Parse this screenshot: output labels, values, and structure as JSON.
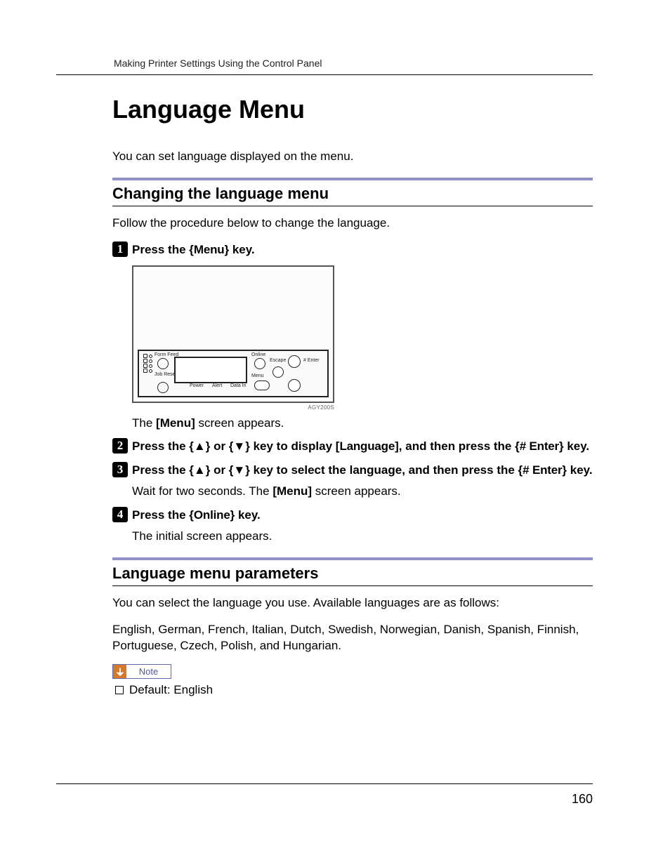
{
  "running_head": "Making Printer Settings Using the Control Panel",
  "title": "Language Menu",
  "intro": "You can set language displayed on the menu.",
  "section1": {
    "heading": "Changing the language menu",
    "lead": "Follow the procedure below to change the language."
  },
  "steps": {
    "s1": {
      "num": "1",
      "pre": "Press the ",
      "key_open": "{",
      "key_label": "Menu",
      "key_close": "}",
      "post": " key.",
      "follow": "The [Menu] screen appears."
    },
    "s2": {
      "num": "2",
      "pre": "Press the ",
      "k1o": "{",
      "k1": "▲",
      "k1c": "}",
      "or": " or ",
      "k2o": "{",
      "k2": "▼",
      "k2c": "}",
      "mid": " key to display ",
      "target_o": "[",
      "target": "Language",
      "target_c": "]",
      "mid2": ", and then press the ",
      "k3o": "{",
      "k3": "# Enter",
      "k3c": "}",
      "post": " key."
    },
    "s3": {
      "num": "3",
      "pre": "Press the ",
      "k1o": "{",
      "k1": "▲",
      "k1c": "}",
      "or": " or ",
      "k2o": "{",
      "k2": "▼",
      "k2c": "}",
      "mid": " key to select the language, and then press the ",
      "k3o": "{",
      "k3": "# Enter",
      "k3c": "}",
      "post": " key.",
      "follow": "Wait for two seconds. The [Menu] screen appears."
    },
    "s4": {
      "num": "4",
      "pre": "Press the ",
      "key_open": "{",
      "key_label": "Online",
      "key_close": "}",
      "post": " key.",
      "follow": "The initial screen appears."
    }
  },
  "panel": {
    "caption": "AGY200S",
    "labels": {
      "form_feed": "Form Feed",
      "job_reset": "Job Reset",
      "power": "Power",
      "alert": "Alert",
      "data_in": "Data In",
      "online": "Online",
      "escape": "Escape",
      "enter": "# Enter",
      "menu": "Menu"
    }
  },
  "section2": {
    "heading": "Language menu parameters",
    "p1": "You can select the language you use. Available languages are as follows:",
    "p2": "English, German, French, Italian, Dutch, Swedish, Norwegian, Danish, Spanish, Finnish, Portuguese, Czech, Polish, and Hungarian.",
    "note_label": "Note",
    "default_line": "Default: English"
  },
  "page_number": "160"
}
